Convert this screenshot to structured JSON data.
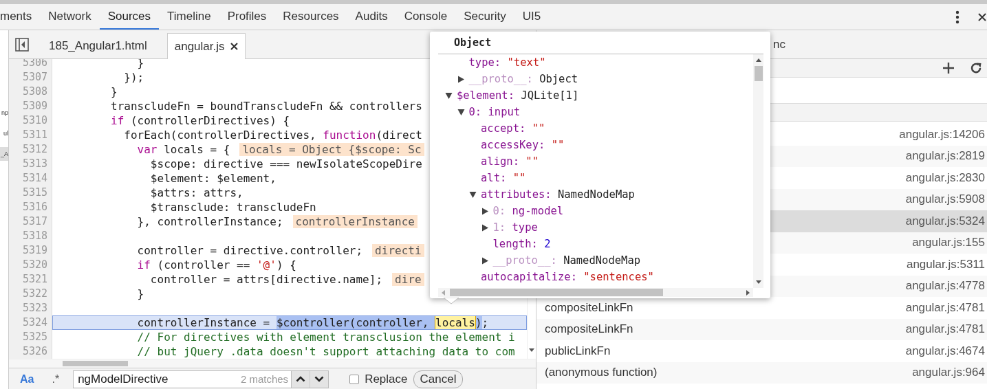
{
  "main_tabs": [
    {
      "label": "ments",
      "selected": false
    },
    {
      "label": "Network",
      "selected": false
    },
    {
      "label": "Sources",
      "selected": true
    },
    {
      "label": "Timeline",
      "selected": false
    },
    {
      "label": "Profiles",
      "selected": false
    },
    {
      "label": "Resources",
      "selected": false
    },
    {
      "label": "Audits",
      "selected": false
    },
    {
      "label": "Console",
      "selected": false
    },
    {
      "label": "Security",
      "selected": false
    },
    {
      "label": "UI5",
      "selected": false
    }
  ],
  "navigator_items": [
    {
      "text": "np",
      "selected": false
    },
    {
      "text": "ul",
      "selected": false
    },
    {
      "text": "_A",
      "selected": true
    }
  ],
  "file_tabs": [
    {
      "label": "185_Angular1.html",
      "selected": false,
      "closable": false
    },
    {
      "label": "angular.js",
      "selected": true,
      "closable": true
    }
  ],
  "code": {
    "lines": [
      {
        "number": "5306",
        "highlighted": false,
        "tokens": [
          {
            "kind": "plain",
            "text": "            }"
          }
        ]
      },
      {
        "number": "5307",
        "highlighted": false,
        "tokens": [
          {
            "kind": "plain",
            "text": "          });"
          }
        ]
      },
      {
        "number": "5308",
        "highlighted": false,
        "tokens": [
          {
            "kind": "plain",
            "text": "        }"
          }
        ]
      },
      {
        "number": "5309",
        "highlighted": false,
        "tokens": [
          {
            "kind": "plain",
            "text": "        transcludeFn = boundTranscludeFn && controllers"
          }
        ]
      },
      {
        "number": "5310",
        "highlighted": false,
        "tokens": [
          {
            "kind": "keyword",
            "text": "        if"
          },
          {
            "kind": "plain",
            "text": " (controllerDirectives) {"
          }
        ]
      },
      {
        "number": "5311",
        "highlighted": false,
        "tokens": [
          {
            "kind": "plain",
            "text": "          forEach(controllerDirectives, "
          },
          {
            "kind": "keyword",
            "text": "function"
          },
          {
            "kind": "plain",
            "text": "(direct"
          }
        ]
      },
      {
        "number": "5312",
        "highlighted": false,
        "tokens": [
          {
            "kind": "keyword",
            "text": "            var"
          },
          {
            "kind": "plain",
            "text": " locals = {"
          },
          {
            "kind": "value",
            "text": "locals = Object {$scope: Sc"
          }
        ]
      },
      {
        "number": "5313",
        "highlighted": false,
        "tokens": [
          {
            "kind": "plain",
            "text": "              $scope: directive === newIsolateScopeDire"
          }
        ]
      },
      {
        "number": "5314",
        "highlighted": false,
        "tokens": [
          {
            "kind": "plain",
            "text": "              $element: $element,"
          }
        ]
      },
      {
        "number": "5315",
        "highlighted": false,
        "tokens": [
          {
            "kind": "plain",
            "text": "              $attrs: attrs,"
          }
        ]
      },
      {
        "number": "5316",
        "highlighted": false,
        "tokens": [
          {
            "kind": "plain",
            "text": "              $transclude: transcludeFn"
          }
        ]
      },
      {
        "number": "5317",
        "highlighted": false,
        "tokens": [
          {
            "kind": "plain",
            "text": "            }, controllerInstance;"
          },
          {
            "kind": "value",
            "text": "controllerInstance"
          }
        ]
      },
      {
        "number": "5318",
        "highlighted": false
      },
      {
        "number": "5319",
        "highlighted": false,
        "tokens": [
          {
            "kind": "plain",
            "text": "            controller = directive.controller;"
          },
          {
            "kind": "value",
            "text": "directi"
          }
        ]
      },
      {
        "number": "5320",
        "highlighted": false,
        "tokens": [
          {
            "kind": "keyword",
            "text": "            if"
          },
          {
            "kind": "plain",
            "text": " (controller == "
          },
          {
            "kind": "string",
            "text": "'@'"
          },
          {
            "kind": "plain",
            "text": ") {"
          }
        ]
      },
      {
        "number": "5321",
        "highlighted": false,
        "tokens": [
          {
            "kind": "plain",
            "text": "              controller = attrs[directive.name];"
          },
          {
            "kind": "value",
            "text": "dire"
          }
        ]
      },
      {
        "number": "5322",
        "highlighted": false,
        "tokens": [
          {
            "kind": "plain",
            "text": "            }"
          }
        ]
      },
      {
        "number": "5323",
        "highlighted": false
      },
      {
        "number": "5324",
        "highlighted": true,
        "tokens": [
          {
            "kind": "plain",
            "text": "            controllerInstance = "
          },
          {
            "kind": "selection",
            "text": "$controller(controller, "
          },
          {
            "kind": "match",
            "text": "locals"
          },
          {
            "kind": "selection",
            "text": ")"
          },
          {
            "kind": "plain",
            "text": ";"
          }
        ]
      },
      {
        "number": "5325",
        "highlighted": false,
        "tokens": [
          {
            "kind": "comment",
            "text": "            // For directives with element transclusion the element i"
          }
        ]
      },
      {
        "number": "5326",
        "highlighted": false,
        "tokens": [
          {
            "kind": "comment",
            "text": "            // but jQuery .data doesn't support attaching data to com"
          }
        ]
      }
    ]
  },
  "search": {
    "options": [
      {
        "label": "Aa",
        "selected": true
      },
      {
        "label": ".*",
        "selected": false
      }
    ],
    "value": "ngModelDirective",
    "match_count": "2 matches",
    "replace": {
      "label": "Replace",
      "checked": false
    },
    "cancel": "Cancel"
  },
  "popup": {
    "title": "Object",
    "tree": [
      {
        "kind": "scrolled",
        "children": [
          {
            "kind": "leaf",
            "tokens": [
              {
                "kind": "key",
                "text": "type:"
              },
              {
                "kind": "string",
                "text": "\"text\""
              }
            ]
          },
          {
            "kind": "branch",
            "expanded": false,
            "tokens": [
              {
                "kind": "dim_key",
                "text": "__proto__:"
              },
              {
                "kind": "object",
                "text": "Object"
              }
            ]
          }
        ]
      },
      {
        "kind": "branch",
        "expanded": true,
        "tokens": [
          {
            "kind": "key",
            "text": "$element:"
          },
          {
            "kind": "object",
            "text": "JQLite[1]"
          }
        ],
        "children": [
          {
            "kind": "branch",
            "expanded": true,
            "tokens": [
              {
                "kind": "key",
                "text": "0:"
              },
              {
                "kind": "node",
                "text": "input"
              }
            ],
            "children": [
              {
                "kind": "leaf",
                "tokens": [
                  {
                    "kind": "key",
                    "text": "accept:"
                  },
                  {
                    "kind": "string",
                    "text": "\"\""
                  }
                ]
              },
              {
                "kind": "leaf",
                "tokens": [
                  {
                    "kind": "key",
                    "text": "accessKey:"
                  },
                  {
                    "kind": "string",
                    "text": "\"\""
                  }
                ]
              },
              {
                "kind": "leaf",
                "tokens": [
                  {
                    "kind": "key",
                    "text": "align:"
                  },
                  {
                    "kind": "string",
                    "text": "\"\""
                  }
                ]
              },
              {
                "kind": "leaf",
                "tokens": [
                  {
                    "kind": "key",
                    "text": "alt:"
                  },
                  {
                    "kind": "string",
                    "text": "\"\""
                  }
                ]
              },
              {
                "kind": "branch",
                "expanded": true,
                "tokens": [
                  {
                    "kind": "key",
                    "text": "attributes:"
                  },
                  {
                    "kind": "object",
                    "text": "NamedNodeMap"
                  }
                ],
                "children": [
                  {
                    "kind": "branch",
                    "expanded": false,
                    "tokens": [
                      {
                        "kind": "dim_key",
                        "text": "0:"
                      },
                      {
                        "kind": "node",
                        "text": "ng-model"
                      }
                    ]
                  },
                  {
                    "kind": "branch",
                    "expanded": false,
                    "tokens": [
                      {
                        "kind": "dim_key",
                        "text": "1:"
                      },
                      {
                        "kind": "node",
                        "text": "type"
                      }
                    ]
                  },
                  {
                    "kind": "leaf",
                    "tokens": [
                      {
                        "kind": "key",
                        "text": "length:"
                      },
                      {
                        "kind": "number",
                        "text": "2"
                      }
                    ]
                  },
                  {
                    "kind": "branch",
                    "expanded": false,
                    "tokens": [
                      {
                        "kind": "dim_key",
                        "text": "__proto__:"
                      },
                      {
                        "kind": "object",
                        "text": "NamedNodeMap"
                      }
                    ]
                  }
                ]
              },
              {
                "kind": "leaf",
                "tokens": [
                  {
                    "kind": "key",
                    "text": "autocapitalize:"
                  },
                  {
                    "kind": "string",
                    "text": "\"sentences\""
                  }
                ]
              }
            ]
          }
        ]
      }
    ]
  },
  "right_panel": {
    "header_text": "nc",
    "call_stack": [
      {
        "location": "angular.js:14206",
        "selected": false
      },
      {
        "location": "angular.js:2819",
        "selected": false
      },
      {
        "location": "angular.js:2830",
        "selected": false
      },
      {
        "location": "angular.js:5908",
        "selected": false
      },
      {
        "location": "angular.js:5324",
        "selected": true
      },
      {
        "location": "angular.js:155",
        "selected": false
      },
      {
        "location": "angular.js:5311",
        "selected": false
      },
      {
        "location": "angular.js:4778",
        "selected": false
      },
      {
        "function": "compositeLinkFn",
        "location": "angular.js:4781",
        "selected": false
      },
      {
        "function": "compositeLinkFn",
        "location": "angular.js:4781",
        "selected": false
      },
      {
        "function": "publicLinkFn",
        "location": "angular.js:4674",
        "selected": false
      },
      {
        "function": "(anonymous function)",
        "location": "angular.js:964",
        "selected": false
      }
    ]
  }
}
